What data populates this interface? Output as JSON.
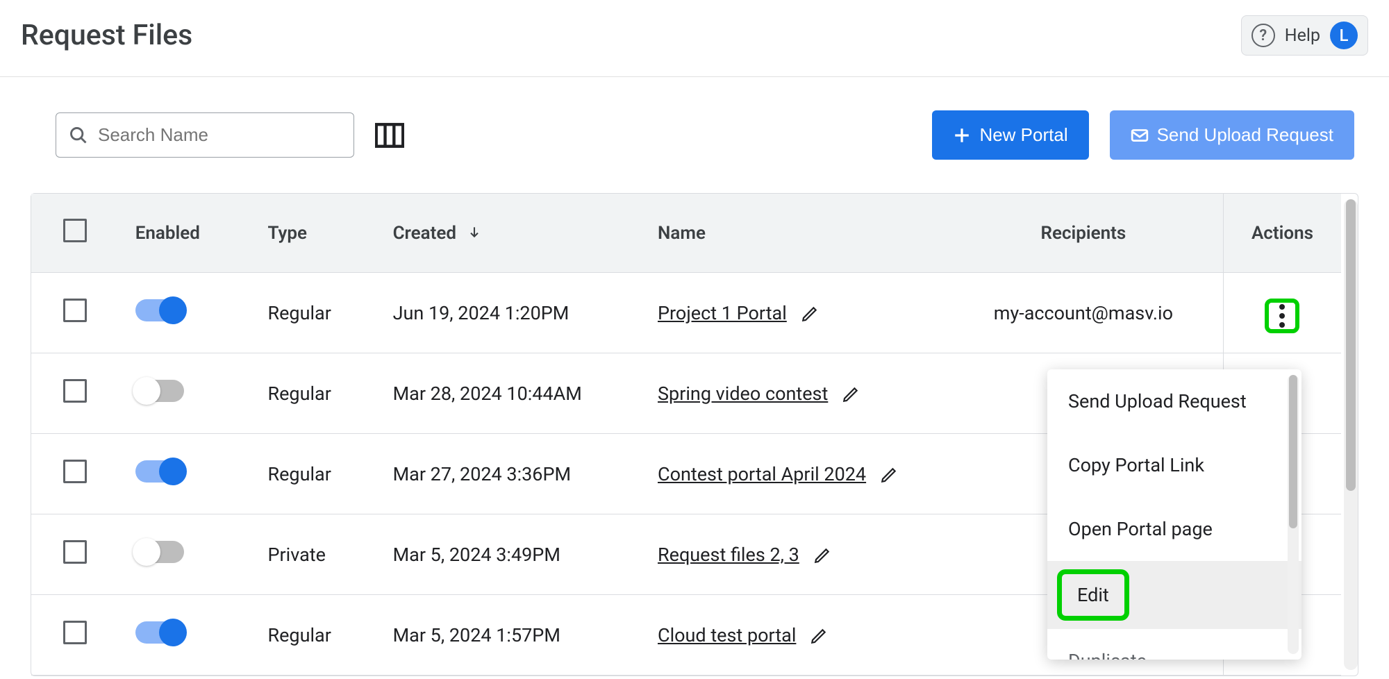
{
  "header": {
    "title": "Request Files",
    "help_label": "Help",
    "avatar_initial": "L"
  },
  "toolbar": {
    "search_placeholder": "Search Name",
    "new_portal_label": "New Portal",
    "send_request_label": "Send Upload Request"
  },
  "table": {
    "headers": {
      "enabled": "Enabled",
      "type": "Type",
      "created": "Created",
      "name": "Name",
      "recipients": "Recipients",
      "actions": "Actions"
    },
    "rows": [
      {
        "enabled": true,
        "type": "Regular",
        "created": "Jun 19, 2024 1:20PM",
        "name": "Project 1 Portal",
        "recipients": "my-account@masv.io",
        "actions_highlight": true
      },
      {
        "enabled": false,
        "type": "Regular",
        "created": "Mar 28, 2024 10:44AM",
        "name": "Spring video contest",
        "recipients": ""
      },
      {
        "enabled": true,
        "type": "Regular",
        "created": "Mar 27, 2024 3:36PM",
        "name": "Contest portal April 2024",
        "recipients": ""
      },
      {
        "enabled": false,
        "type": "Private",
        "created": "Mar 5, 2024 3:49PM",
        "name": "Request files 2, 3",
        "recipients": ""
      },
      {
        "enabled": true,
        "type": "Regular",
        "created": "Mar 5, 2024 1:57PM",
        "name": "Cloud test portal",
        "recipients": ""
      }
    ]
  },
  "dropdown": {
    "items": [
      "Send Upload Request",
      "Copy Portal Link",
      "Open Portal page",
      "Edit",
      "Duplicate"
    ],
    "highlight_index": 3
  }
}
